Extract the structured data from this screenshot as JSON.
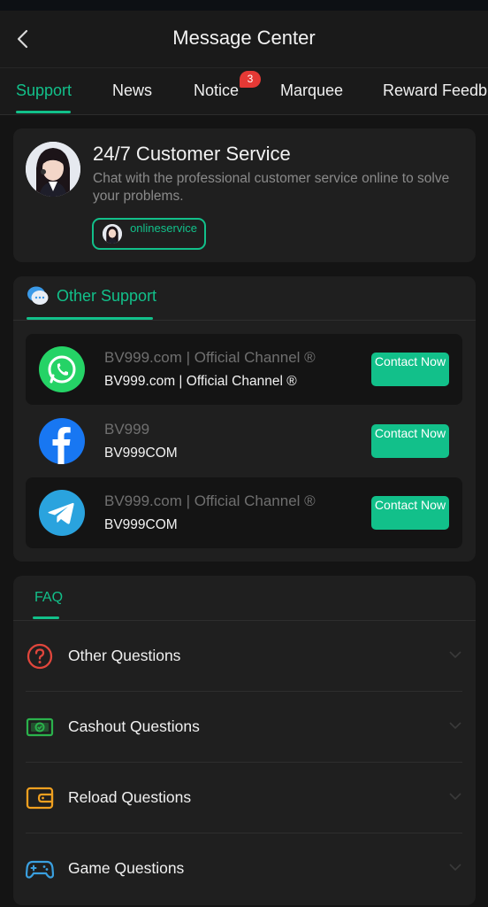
{
  "header": {
    "title": "Message Center",
    "back_icon": "chevron-left-icon"
  },
  "tabs": [
    {
      "label": "Support",
      "active": true
    },
    {
      "label": "News"
    },
    {
      "label": "Notice",
      "badge": "3"
    },
    {
      "label": "Marquee"
    },
    {
      "label": "Reward Feedb"
    }
  ],
  "customer_service": {
    "title": "24/7 Customer Service",
    "description": "Chat with the professional customer service online to solve your problems.",
    "button_label": "onlineservice"
  },
  "other_support": {
    "heading": "Other Support",
    "channels": [
      {
        "name": "BV999.com | Official Channel ®",
        "sub": "BV999.com | Official Channel ®",
        "button": "Contact Now",
        "icon": "whatsapp-icon",
        "color": "#25d366"
      },
      {
        "name": "BV999",
        "sub": "BV999COM",
        "button": "Contact Now",
        "icon": "facebook-icon",
        "color": "#1877f2"
      },
      {
        "name": "BV999.com | Official Channel ®",
        "sub": "BV999COM",
        "button": "Contact Now",
        "icon": "telegram-icon",
        "color": "#2aa3de"
      }
    ]
  },
  "faq": {
    "heading": "FAQ",
    "items": [
      {
        "label": "Other Questions",
        "icon": "question-icon",
        "color": "#e0463c"
      },
      {
        "label": "Cashout Questions",
        "icon": "cash-icon",
        "color": "#2bb24c"
      },
      {
        "label": "Reload Questions",
        "icon": "wallet-icon",
        "color": "#f0a020"
      },
      {
        "label": "Game Questions",
        "icon": "gamepad-icon",
        "color": "#3aa0e0"
      }
    ]
  },
  "colors": {
    "accent": "#12c08a",
    "background": "#141414",
    "card": "#1f1f1f"
  }
}
